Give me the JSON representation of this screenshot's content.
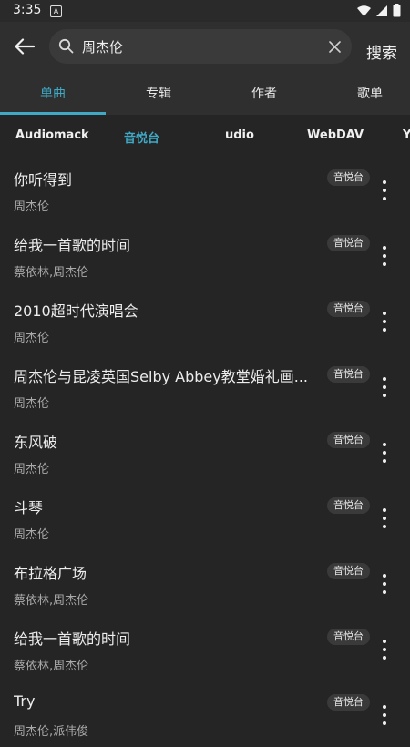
{
  "status_bar": {
    "time": "3:35",
    "notification_glyph": "A"
  },
  "header": {
    "search_value": "周杰伦",
    "search_button_label": "搜索"
  },
  "tabs": [
    {
      "label": "单曲",
      "active": true
    },
    {
      "label": "专辑",
      "active": false
    },
    {
      "label": "作者",
      "active": false
    },
    {
      "label": "歌单",
      "active": false
    }
  ],
  "sources": [
    {
      "label": "Audiomack",
      "active": false
    },
    {
      "label": "音悦台",
      "active": true
    },
    {
      "label": "udio",
      "active": false
    },
    {
      "label": "WebDAV",
      "active": false
    },
    {
      "label": "Y",
      "active": false
    }
  ],
  "songs": [
    {
      "title": "你听得到",
      "artist": "周杰伦",
      "source": "音悦台"
    },
    {
      "title": "给我一首歌的时间",
      "artist": "蔡依林,周杰伦",
      "source": "音悦台"
    },
    {
      "title": "2010超时代演唱会",
      "artist": "周杰伦",
      "source": "音悦台"
    },
    {
      "title": "周杰伦与昆凌英国Selby Abbey教堂婚礼画...",
      "artist": "周杰伦",
      "source": "音悦台"
    },
    {
      "title": "东风破",
      "artist": "周杰伦",
      "source": "音悦台"
    },
    {
      "title": "斗琴",
      "artist": "周杰伦",
      "source": "音悦台"
    },
    {
      "title": "布拉格广场",
      "artist": "蔡依林,周杰伦",
      "source": "音悦台"
    },
    {
      "title": "给我一首歌的时间",
      "artist": "蔡依林,周杰伦",
      "source": "音悦台"
    },
    {
      "title": "Try",
      "artist": "周杰伦,派伟俊",
      "source": "音悦台"
    }
  ],
  "colors": {
    "accent": "#3fa9c6",
    "background": "#252525",
    "bar": "#2f2f2f"
  },
  "icons": [
    "back-arrow-icon",
    "search-icon",
    "clear-icon",
    "more-vert-icon",
    "wifi-icon",
    "signal-icon",
    "battery-icon"
  ]
}
